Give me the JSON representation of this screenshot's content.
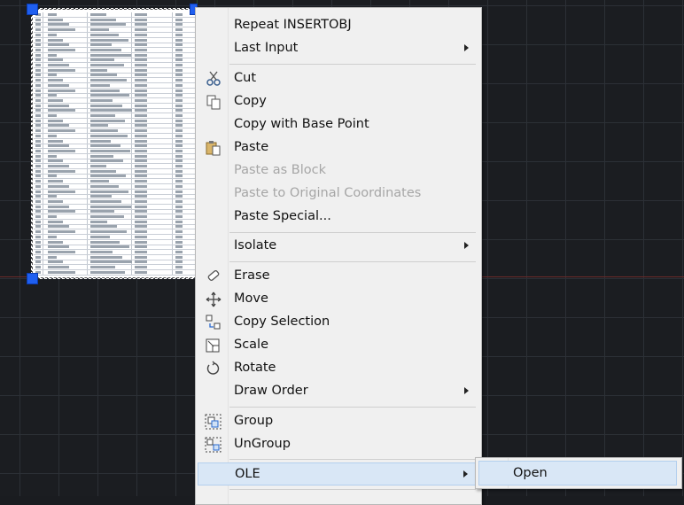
{
  "context_menu": {
    "items": [
      {
        "label": "Repeat INSERTOBJ",
        "icon": "none",
        "enabled": true,
        "submenu": false
      },
      {
        "label": "Last Input",
        "icon": "none",
        "enabled": true,
        "submenu": true
      },
      {
        "label": "Cut",
        "icon": "scissors-icon",
        "enabled": true,
        "submenu": false
      },
      {
        "label": "Copy",
        "icon": "copy-icon",
        "enabled": true,
        "submenu": false
      },
      {
        "label": "Copy with Base Point",
        "icon": "none",
        "enabled": true,
        "submenu": false
      },
      {
        "label": "Paste",
        "icon": "paste-icon",
        "enabled": true,
        "submenu": false
      },
      {
        "label": "Paste as Block",
        "icon": "none",
        "enabled": false,
        "submenu": false
      },
      {
        "label": "Paste to Original Coordinates",
        "icon": "none",
        "enabled": false,
        "submenu": false
      },
      {
        "label": "Paste Special...",
        "icon": "none",
        "enabled": true,
        "submenu": false
      },
      {
        "label": "Isolate",
        "icon": "none",
        "enabled": true,
        "submenu": true
      },
      {
        "label": "Erase",
        "icon": "eraser-icon",
        "enabled": true,
        "submenu": false
      },
      {
        "label": "Move",
        "icon": "move-icon",
        "enabled": true,
        "submenu": false
      },
      {
        "label": "Copy Selection",
        "icon": "copy-selection-icon",
        "enabled": true,
        "submenu": false
      },
      {
        "label": "Scale",
        "icon": "scale-icon",
        "enabled": true,
        "submenu": false
      },
      {
        "label": "Rotate",
        "icon": "rotate-icon",
        "enabled": true,
        "submenu": false
      },
      {
        "label": "Draw Order",
        "icon": "none",
        "enabled": true,
        "submenu": true
      },
      {
        "label": "Group",
        "icon": "group-icon",
        "enabled": true,
        "submenu": false
      },
      {
        "label": "UnGroup",
        "icon": "ungroup-icon",
        "enabled": true,
        "submenu": false
      },
      {
        "label": "OLE",
        "icon": "none",
        "enabled": true,
        "submenu": true,
        "highlighted": true
      }
    ]
  },
  "ole_submenu": {
    "items": [
      {
        "label": "Open",
        "highlighted": true
      }
    ]
  },
  "colors": {
    "canvas_bg": "#1b1d21",
    "grid_line": "#2c3036",
    "menu_bg": "#f0f0f0",
    "highlight": "#d9e7f6",
    "grip": "#1f5ff0",
    "disabled_text": "#a6a6a6"
  }
}
